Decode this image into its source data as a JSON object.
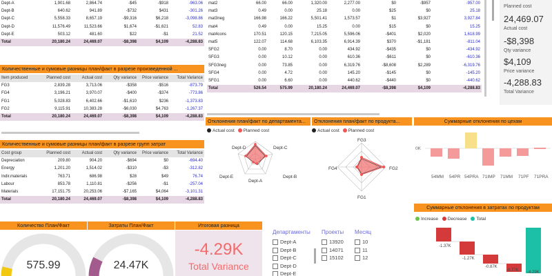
{
  "colors": {
    "orange": "#f7931e",
    "total_row": "#e7d6e3",
    "negative_text": "#2b2bd0",
    "actual": "#222222",
    "planned": "#f25555",
    "increase": "#6cc24a",
    "decrease": "#d43a3a",
    "total": "#1cc0a6",
    "card_bg": "#efe4ec",
    "variance_text": "#f26b6b"
  },
  "dept_table": {
    "rows": [
      [
        "Dept-A",
        "1,901.68",
        "2,864.74",
        "-$45",
        "-$918",
        "-963.06"
      ],
      [
        "Dept-B",
        "640.62",
        "941.89",
        "-$732",
        "$431",
        "-301.26"
      ],
      [
        "Dept-C",
        "5,558.33",
        "8,657.19",
        "-$9,316",
        "$6,218",
        "-3,098.86"
      ],
      [
        "Dept-D",
        "11,576.49",
        "11,523.66",
        "$1,674",
        "-$1,621",
        "52.83"
      ],
      [
        "Dept-E",
        "503.12",
        "481.60",
        "$22",
        "-$1",
        "21.52"
      ]
    ],
    "total": [
      "Total",
      "20,180.24",
      "24,469.07",
      "-$8,398",
      "$4,109",
      "-4,288.83"
    ]
  },
  "product_table": {
    "title": "Количественные и сумовые разницы план/факт в разрезе произведенной ...",
    "headers": [
      "Item produced",
      "Planned cost",
      "Actual cost",
      "Qty variance",
      "Price variance",
      "Total Variance"
    ],
    "rows": [
      [
        "FG3",
        "2,839.28",
        "3,713.06",
        "-$358",
        "-$516",
        "-873.79"
      ],
      [
        "FG4",
        "3,196.21",
        "3,970.07",
        "-$400",
        "-$374",
        "-773.86"
      ],
      [
        "FG1",
        "5,028.83",
        "6,402.66",
        "-$1,610",
        "$236",
        "-1,373.83"
      ],
      [
        "FG2",
        "9,115.91",
        "10,383.28",
        "-$6,030",
        "$4,763",
        "-1,267.37"
      ]
    ],
    "total": [
      "Total",
      "20,180.24",
      "24,469.07",
      "-$8,398",
      "$4,109",
      "-4,288.83"
    ]
  },
  "cost_group_table": {
    "title": "Количественные и сумовые разницы план/факт в разрезе групп затрат",
    "headers": [
      "Cost group",
      "Planned cost",
      "Actual cost",
      "Qty variance",
      "Price variance",
      "Total Variance"
    ],
    "rows": [
      [
        "Depreciation",
        "209.80",
        "904.20",
        "-$694",
        "$0",
        "-694.40"
      ],
      [
        "Energy",
        "1,201.20",
        "1,514.02",
        "-$310",
        "-$3",
        "-312.82"
      ],
      [
        "Indir.materials",
        "763.71",
        "686.98",
        "$28",
        "$49",
        "76.74"
      ],
      [
        "Labour",
        "853.78",
        "1,110.81",
        "-$256",
        "-$1",
        "-257.04"
      ],
      [
        "Materials",
        "17,151.75",
        "20,253.06",
        "-$7,165",
        "$4,064",
        "-3,101.31"
      ]
    ],
    "total": [
      "Total",
      "20,180.24",
      "24,469.07",
      "-$8,398",
      "$4,109",
      "-4,288.83"
    ]
  },
  "material_table": {
    "rows": [
      [
        "mat2",
        "66.00",
        "66.00",
        "1,320.00",
        "2,277.00",
        "$0",
        "-$957",
        "-957.00"
      ],
      [
        "mat3",
        "0.49",
        "0.00",
        "25.18",
        "0.00",
        "$25",
        "$0",
        "25.18"
      ],
      [
        "mat3neg",
        "166.98",
        "166.22",
        "5,501.41",
        "1,573.57",
        "$1",
        "$3,927",
        "3,927.84"
      ],
      [
        "mat4",
        "0.49",
        "0.00",
        "15.25",
        "0.00",
        "$15",
        "$0",
        "15.25"
      ],
      [
        "mat4cons",
        "170.51",
        "120.15",
        "7,215.05",
        "5,596.06",
        "-$401",
        "$2,020",
        "1,618.99"
      ],
      [
        "mat5",
        "122.07",
        "114.68",
        "6,103.35",
        "6,914.39",
        "$370",
        "-$1,181",
        "-811.04"
      ],
      [
        "SFG2",
        "0.00",
        "8.70",
        "0.00",
        "434.92",
        "-$435",
        "$0",
        "-434.92"
      ],
      [
        "SFG3",
        "0.00",
        "10.12",
        "0.00",
        "610.36",
        "-$611",
        "$0",
        "-610.36"
      ],
      [
        "SFG3neg",
        "0.00",
        "73.85",
        "0.00",
        "6,319.76",
        "-$8,608",
        "$2,289",
        "-6,319.76"
      ],
      [
        "SFG4",
        "0.00",
        "4.72",
        "0.00",
        "145.20",
        "-$145",
        "$0",
        "-145.20"
      ],
      [
        "SFG1",
        "0.00",
        "6.60",
        "0.00",
        "440.62",
        "-$440",
        "$0",
        "-440.62"
      ]
    ],
    "total": [
      "Total",
      "526.54",
      "575.99",
      "20,180.24",
      "24,469.07",
      "-$8,398",
      "$4,109",
      "-4,288.83"
    ]
  },
  "cards": {
    "planned_label": "Planned cost",
    "actual_value": "24,469.07",
    "actual_label": "Actual cost",
    "qty_value": "-$8,398",
    "qty_label": "Qty variance",
    "price_value": "$4,109",
    "price_label": "Price variance",
    "total_value": "-4,288.83",
    "total_label": "Total Variance"
  },
  "radar_dept": {
    "title": "Отклонения план/факт по департамента...",
    "legend_actual": "Actual cost",
    "legend_planned": "Planned cost",
    "labels": [
      "Dept-C",
      "Dept-B",
      "Dept-A",
      "Dept-E",
      "Dept-D"
    ]
  },
  "radar_product": {
    "title": "Отклонения план/факт по продукта...",
    "legend_actual": "Actual cost",
    "legend_planned": "Planned cost",
    "labels": [
      "FG3",
      "FG2",
      "FG1",
      "FG4"
    ]
  },
  "shop_chart": {
    "title": "Суммарные отклонения по цехам",
    "ytick": "0K",
    "categories": [
      "54MM",
      "54PR",
      "54PRA",
      "71IMP",
      "71MM",
      "71PF",
      "71PRA"
    ]
  },
  "waterfall": {
    "title": "Суммарные отклонения в затратах по продуктам",
    "legend": [
      "Increase",
      "Decrease",
      "Total"
    ],
    "labels": [
      "-1.37K",
      "-1.27K",
      "-0.87K",
      "-0.77K",
      "-4.29K"
    ]
  },
  "gauges": {
    "qty_title": "Количество План/Факт",
    "qty_value": "575.99",
    "cost_title": "Затраты План/Факт",
    "cost_value": "24.47K",
    "variance_title": "Итоговая разница",
    "variance_value": "-4.29K",
    "variance_label": "Total Variance"
  },
  "slicers": {
    "departments_title": "Департаменты",
    "departments": [
      "Dept-A",
      "Dept-B",
      "Dept-C",
      "Dept-D",
      "Dept-E"
    ],
    "projects_title": "Проекты",
    "projects": [
      "13920",
      "14071",
      "15102"
    ],
    "month_title": "Месяц",
    "months": [
      "10",
      "11",
      "12"
    ]
  }
}
